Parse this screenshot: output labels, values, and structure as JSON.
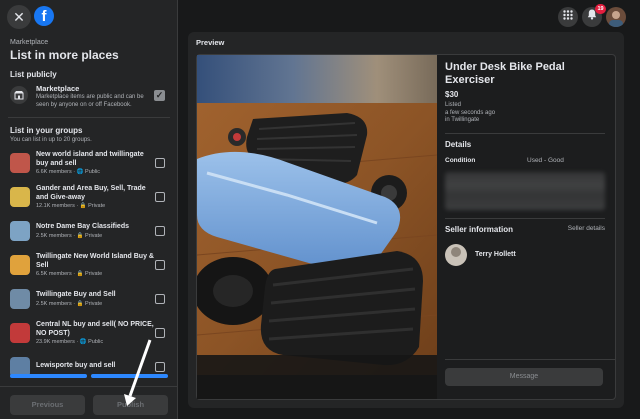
{
  "left": {
    "breadcrumb": "Marketplace",
    "title": "List in more places",
    "list_publicly": "List publicly",
    "marketplace": {
      "name": "Marketplace",
      "desc": "Marketplace items are public and can be seen by anyone on or off Facebook."
    },
    "groups_title": "List in your groups",
    "groups_sub": "You can list in up to 20 groups.",
    "groups": [
      {
        "name": "New world island and twillingate buy and sell",
        "meta": "6.6K members · 🌐 Public",
        "color": "#c0564a"
      },
      {
        "name": "Gander and Area Buy, Sell, Trade and Give-away",
        "meta": "12.1K members · 🔒 Private",
        "color": "#d9b64a"
      },
      {
        "name": "Notre Dame Bay Classifieds",
        "meta": "2.5K members · 🔒 Private",
        "color": "#7da3c4"
      },
      {
        "name": "Twillingate New World Island Buy & Sell",
        "meta": "6.5K members · 🔒 Private",
        "color": "#e0a23c"
      },
      {
        "name": "Twillingate Buy and Sell",
        "meta": "2.5K members · 🔒 Private",
        "color": "#6f8ba6"
      },
      {
        "name": "Central NL buy and sell( NO PRICE, NO POST)",
        "meta": "23.9K members · 🌐 Public",
        "color": "#c23a3a"
      },
      {
        "name": "Lewisporte buy and sell",
        "meta": "",
        "color": "#5e7fa3"
      }
    ],
    "btn_previous": "Previous",
    "btn_publish": "Publish"
  },
  "preview": {
    "label": "Preview",
    "title": "Under Desk Bike Pedal Exerciser",
    "price": "$30",
    "listed": "Listed",
    "time": "a few seconds ago",
    "location": "in Twillingate",
    "details": "Details",
    "condition_label": "Condition",
    "condition_value": "Used - Good",
    "seller_info": "Seller information",
    "seller_details": "Seller details",
    "seller_name": "Terry Hollett",
    "message": "Message"
  },
  "topbar": {
    "notifications_badge": "19"
  },
  "icons": {
    "close": "close-icon",
    "logo": "facebook-logo-icon",
    "menu": "grid-menu-icon",
    "bell": "bell-icon",
    "marketplace": "store-icon"
  }
}
